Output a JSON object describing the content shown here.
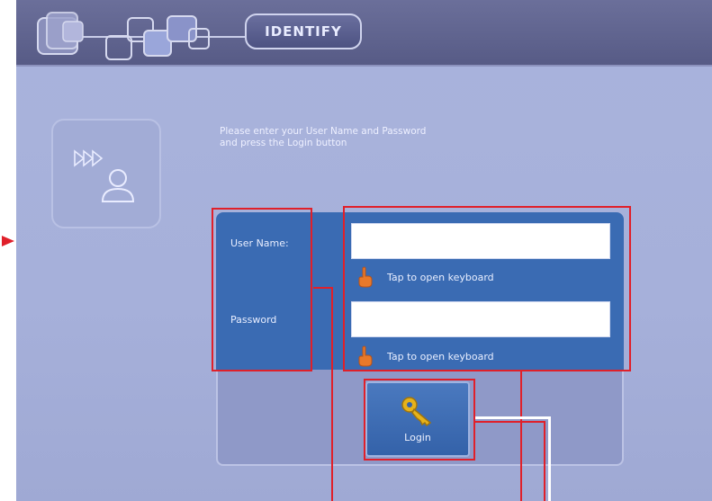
{
  "header": {
    "title": "IDENTIFY"
  },
  "instructions": {
    "line1": "Please enter your User Name and Password",
    "line2": "and press the Login button"
  },
  "form": {
    "username_label": "User Name:",
    "password_label": "Password",
    "username_value": "",
    "password_value": "",
    "keyboard_hint": "Tap to open keyboard"
  },
  "login_button": {
    "label": "Login"
  },
  "icons": {
    "avatar": "user-icon",
    "arrows": "forward-arrows-icon",
    "hand": "pointing-hand-icon",
    "key": "key-icon"
  },
  "colors": {
    "accent": "#3a6bb3",
    "highlight": "#e0202a",
    "key": "#e6b21a"
  }
}
